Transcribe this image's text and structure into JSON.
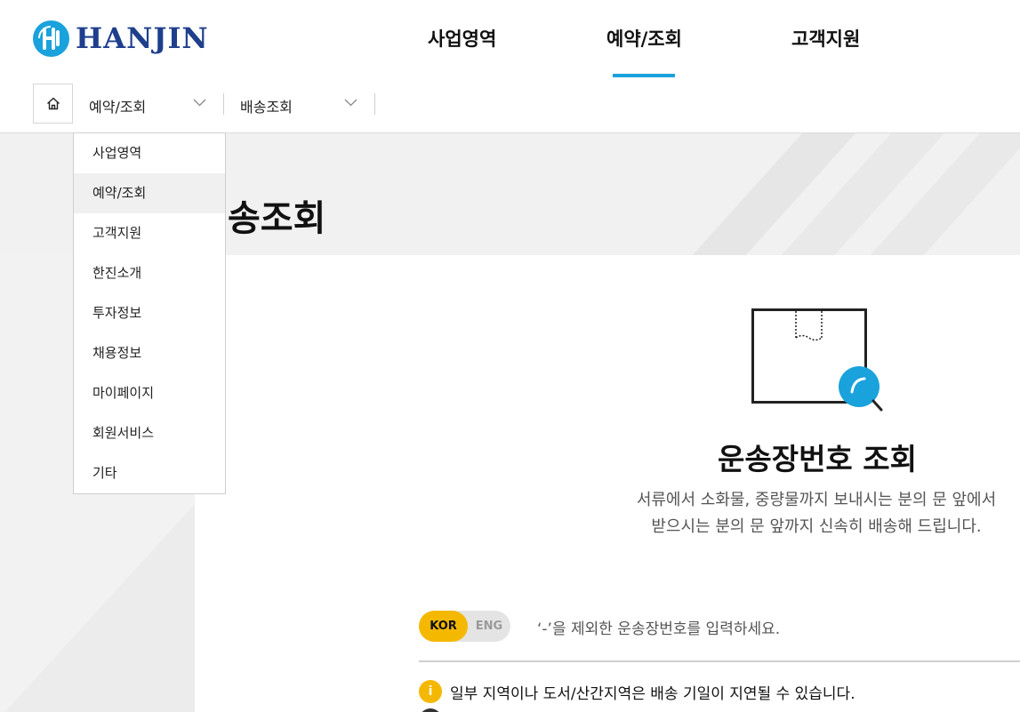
{
  "brand": {
    "name": "HANJIN",
    "accent_color": "#1aa2dc",
    "logo_color": "#1f3f8c",
    "highlight_color": "#f5b800"
  },
  "gnb": {
    "items": [
      {
        "label": "사업영역"
      },
      {
        "label": "예약/조회",
        "active": true
      },
      {
        "label": "고객지원"
      }
    ]
  },
  "location": {
    "home_icon": "home-icon",
    "depth1": "예약/조회",
    "depth2": "배송조회"
  },
  "dropdown": {
    "items": [
      {
        "label": "사업영역"
      },
      {
        "label": "예약/조회",
        "active": true
      },
      {
        "label": "고객지원"
      },
      {
        "label": "한진소개"
      },
      {
        "label": "투자정보"
      },
      {
        "label": "채용정보"
      },
      {
        "label": "마이페이지"
      },
      {
        "label": "회원서비스"
      },
      {
        "label": "기타"
      }
    ]
  },
  "page": {
    "title_visible": "송조회"
  },
  "tracking": {
    "title": "운송장번호 조회",
    "desc_line1": "서류에서 소화물, 중량물까지 보내시는 분의 문 앞에서",
    "desc_line2": "받으시는 분의 문 앞까지 신속히 배송해 드립니다.",
    "lang_kor": "KOR",
    "lang_eng": "ENG",
    "input_hint": "‘-’을 제외한 운송장번호를 입력하세요.",
    "notice_icon": "i",
    "notice": "일부 지역이나 도서/산간지역은 배송 기일이 지연될 수 있습니다."
  }
}
